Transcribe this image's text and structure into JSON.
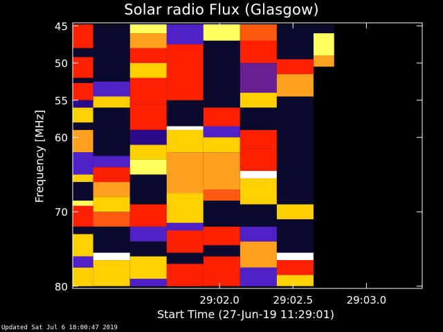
{
  "updated": "Updated Sat Jul  6 18:00:47 2019",
  "chart_data": {
    "type": "heatmap",
    "title": "Solar radio Flux (Glasgow)",
    "xlabel": "Start Time (27-Jun-19 11:29:01)",
    "ylabel": "Frequency [MHz]",
    "x_ticks": [
      {
        "label": "29:02.0",
        "value": 1.0
      },
      {
        "label": "29:02.5",
        "value": 1.5
      },
      {
        "label": "29:03.0",
        "value": 2.0
      }
    ],
    "y_ticks": [
      {
        "label": "45",
        "value": 45
      },
      {
        "label": "50",
        "value": 50
      },
      {
        "label": "55",
        "value": 55
      },
      {
        "label": "60",
        "value": 60
      },
      {
        "label": "70",
        "value": 70
      },
      {
        "label": "80",
        "value": 80
      }
    ],
    "xlim": [
      0.0,
      2.38
    ],
    "ylim": [
      44.6,
      80.3
    ],
    "colormap": [
      "#0a0a2e",
      "#2a0a88",
      "#5020c8",
      "#6a2090",
      "#c0205a",
      "#ff2000",
      "#ff5a10",
      "#ffa020",
      "#ffd000",
      "#ffff60",
      "#ffffff"
    ],
    "columns": [
      {
        "x0": 0.0,
        "x1": 0.14,
        "segments": [
          {
            "from": 44.8,
            "to": 48.0,
            "level": 5
          },
          {
            "from": 48.0,
            "to": 49.2,
            "level": 0
          },
          {
            "from": 49.2,
            "to": 52.0,
            "level": 5
          },
          {
            "from": 52.0,
            "to": 52.7,
            "level": 0
          },
          {
            "from": 52.7,
            "to": 55.0,
            "level": 5
          },
          {
            "from": 55.0,
            "to": 56.0,
            "level": 1
          },
          {
            "from": 56.0,
            "to": 58.0,
            "level": 8
          },
          {
            "from": 58.0,
            "to": 59.0,
            "level": 0
          },
          {
            "from": 59.0,
            "to": 62.0,
            "level": 7
          },
          {
            "from": 62.0,
            "to": 65.0,
            "level": 2
          },
          {
            "from": 65.0,
            "to": 66.0,
            "level": 8
          },
          {
            "from": 66.0,
            "to": 68.5,
            "level": 0
          },
          {
            "from": 68.5,
            "to": 69.2,
            "level": 9
          },
          {
            "from": 69.2,
            "to": 72.0,
            "level": 5
          },
          {
            "from": 72.0,
            "to": 73.0,
            "level": 0
          },
          {
            "from": 73.0,
            "to": 76.0,
            "level": 8
          },
          {
            "from": 76.0,
            "to": 77.5,
            "level": 2
          },
          {
            "from": 77.5,
            "to": 80.0,
            "level": 8
          }
        ]
      },
      {
        "x0": 0.14,
        "x1": 0.39,
        "segments": [
          {
            "from": 44.8,
            "to": 52.5,
            "level": 0
          },
          {
            "from": 52.5,
            "to": 54.5,
            "level": 2
          },
          {
            "from": 54.5,
            "to": 56.0,
            "level": 8
          },
          {
            "from": 56.0,
            "to": 62.5,
            "level": 0
          },
          {
            "from": 62.5,
            "to": 64.0,
            "level": 2
          },
          {
            "from": 64.0,
            "to": 66.0,
            "level": 5
          },
          {
            "from": 66.0,
            "to": 68.0,
            "level": 7
          },
          {
            "from": 68.0,
            "to": 70.0,
            "level": 8
          },
          {
            "from": 70.0,
            "to": 72.0,
            "level": 6
          },
          {
            "from": 72.0,
            "to": 75.5,
            "level": 0
          },
          {
            "from": 75.5,
            "to": 76.5,
            "level": 10
          },
          {
            "from": 76.5,
            "to": 80.0,
            "level": 8
          }
        ]
      },
      {
        "x0": 0.39,
        "x1": 0.64,
        "segments": [
          {
            "from": 44.8,
            "to": 46.0,
            "level": 9
          },
          {
            "from": 46.0,
            "to": 48.0,
            "level": 7
          },
          {
            "from": 48.0,
            "to": 50.0,
            "level": 5
          },
          {
            "from": 50.0,
            "to": 52.0,
            "level": 8
          },
          {
            "from": 52.0,
            "to": 55.5,
            "level": 5
          },
          {
            "from": 55.5,
            "to": 59.0,
            "level": 5
          },
          {
            "from": 59.0,
            "to": 61.0,
            "level": 1
          },
          {
            "from": 61.0,
            "to": 63.0,
            "level": 8
          },
          {
            "from": 63.0,
            "to": 65.0,
            "level": 9
          },
          {
            "from": 65.0,
            "to": 69.0,
            "level": 0
          },
          {
            "from": 69.0,
            "to": 72.0,
            "level": 5
          },
          {
            "from": 72.0,
            "to": 74.0,
            "level": 2
          },
          {
            "from": 74.0,
            "to": 76.0,
            "level": 0
          },
          {
            "from": 76.0,
            "to": 79.0,
            "level": 8
          },
          {
            "from": 79.0,
            "to": 80.0,
            "level": 2
          }
        ]
      },
      {
        "x0": 0.64,
        "x1": 0.89,
        "segments": [
          {
            "from": 44.8,
            "to": 47.5,
            "level": 2
          },
          {
            "from": 47.5,
            "to": 55.0,
            "level": 5
          },
          {
            "from": 55.0,
            "to": 58.5,
            "level": 0
          },
          {
            "from": 58.5,
            "to": 59.0,
            "level": 10
          },
          {
            "from": 59.0,
            "to": 62.0,
            "level": 8
          },
          {
            "from": 62.0,
            "to": 67.5,
            "level": 7
          },
          {
            "from": 67.5,
            "to": 71.5,
            "level": 8
          },
          {
            "from": 71.5,
            "to": 72.5,
            "level": 2
          },
          {
            "from": 72.5,
            "to": 75.5,
            "level": 5
          },
          {
            "from": 75.5,
            "to": 77.0,
            "level": 0
          },
          {
            "from": 77.0,
            "to": 80.0,
            "level": 5
          }
        ]
      },
      {
        "x0": 0.89,
        "x1": 1.14,
        "segments": [
          {
            "from": 44.8,
            "to": 47.0,
            "level": 9
          },
          {
            "from": 47.0,
            "to": 56.0,
            "level": 0
          },
          {
            "from": 56.0,
            "to": 58.5,
            "level": 5
          },
          {
            "from": 58.5,
            "to": 60.0,
            "level": 2
          },
          {
            "from": 60.0,
            "to": 62.0,
            "level": 8
          },
          {
            "from": 62.0,
            "to": 67.0,
            "level": 7
          },
          {
            "from": 67.0,
            "to": 68.5,
            "level": 6
          },
          {
            "from": 68.5,
            "to": 72.0,
            "level": 0
          },
          {
            "from": 72.0,
            "to": 74.5,
            "level": 5
          },
          {
            "from": 74.5,
            "to": 76.0,
            "level": 0
          },
          {
            "from": 76.0,
            "to": 80.0,
            "level": 5
          }
        ]
      },
      {
        "x0": 1.14,
        "x1": 1.39,
        "segments": [
          {
            "from": 44.8,
            "to": 47.0,
            "level": 6
          },
          {
            "from": 47.0,
            "to": 50.0,
            "level": 5
          },
          {
            "from": 50.0,
            "to": 54.0,
            "level": 3
          },
          {
            "from": 54.0,
            "to": 56.0,
            "level": 8
          },
          {
            "from": 56.0,
            "to": 59.0,
            "level": 0
          },
          {
            "from": 59.0,
            "to": 61.5,
            "level": 5
          },
          {
            "from": 61.5,
            "to": 64.5,
            "level": 5
          },
          {
            "from": 64.5,
            "to": 65.5,
            "level": 10
          },
          {
            "from": 65.5,
            "to": 69.0,
            "level": 8
          },
          {
            "from": 69.0,
            "to": 72.0,
            "level": 0
          },
          {
            "from": 72.0,
            "to": 74.0,
            "level": 2
          },
          {
            "from": 74.0,
            "to": 77.5,
            "level": 7
          },
          {
            "from": 77.5,
            "to": 80.0,
            "level": 2
          }
        ]
      },
      {
        "x0": 1.39,
        "x1": 1.64,
        "segments": [
          {
            "from": 44.8,
            "to": 49.5,
            "level": 0
          },
          {
            "from": 49.5,
            "to": 51.5,
            "level": 5
          },
          {
            "from": 51.5,
            "to": 54.5,
            "level": 7
          },
          {
            "from": 54.5,
            "to": 69.0,
            "level": 0
          },
          {
            "from": 69.0,
            "to": 71.0,
            "level": 8
          },
          {
            "from": 71.0,
            "to": 75.5,
            "level": 0
          },
          {
            "from": 75.5,
            "to": 76.5,
            "level": 10
          },
          {
            "from": 76.5,
            "to": 78.5,
            "level": 5
          },
          {
            "from": 78.5,
            "to": 80.0,
            "level": 8
          }
        ]
      },
      {
        "x0": 1.64,
        "x1": 1.78,
        "segments": [
          {
            "from": 44.8,
            "to": 46.0,
            "level": 0
          },
          {
            "from": 46.0,
            "to": 49.0,
            "level": 9
          },
          {
            "from": 49.0,
            "to": 50.5,
            "level": 7
          },
          {
            "from": 50.5,
            "to": 80.0,
            "level": -1
          }
        ]
      }
    ]
  }
}
